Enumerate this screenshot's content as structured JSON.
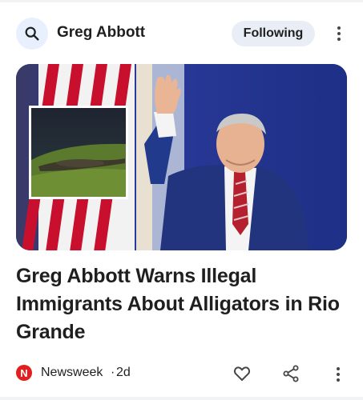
{
  "header": {
    "topic_title": "Greg Abbott",
    "following_label": "Following"
  },
  "article": {
    "headline": "Greg Abbott Warns Illegal Immigrants About Alligators in Rio Grande",
    "source_logo_letter": "N",
    "source_name": "Newsweek",
    "separator": "·",
    "age": "2d"
  },
  "icons": {
    "search": "search-icon",
    "more_top": "more-vert-icon",
    "like": "heart-icon",
    "share": "share-icon",
    "more_bottom": "more-vert-icon"
  },
  "colors": {
    "search_bg": "#e8f0fe",
    "chip_bg": "#e9eef6",
    "brand_red": "#e02020"
  }
}
